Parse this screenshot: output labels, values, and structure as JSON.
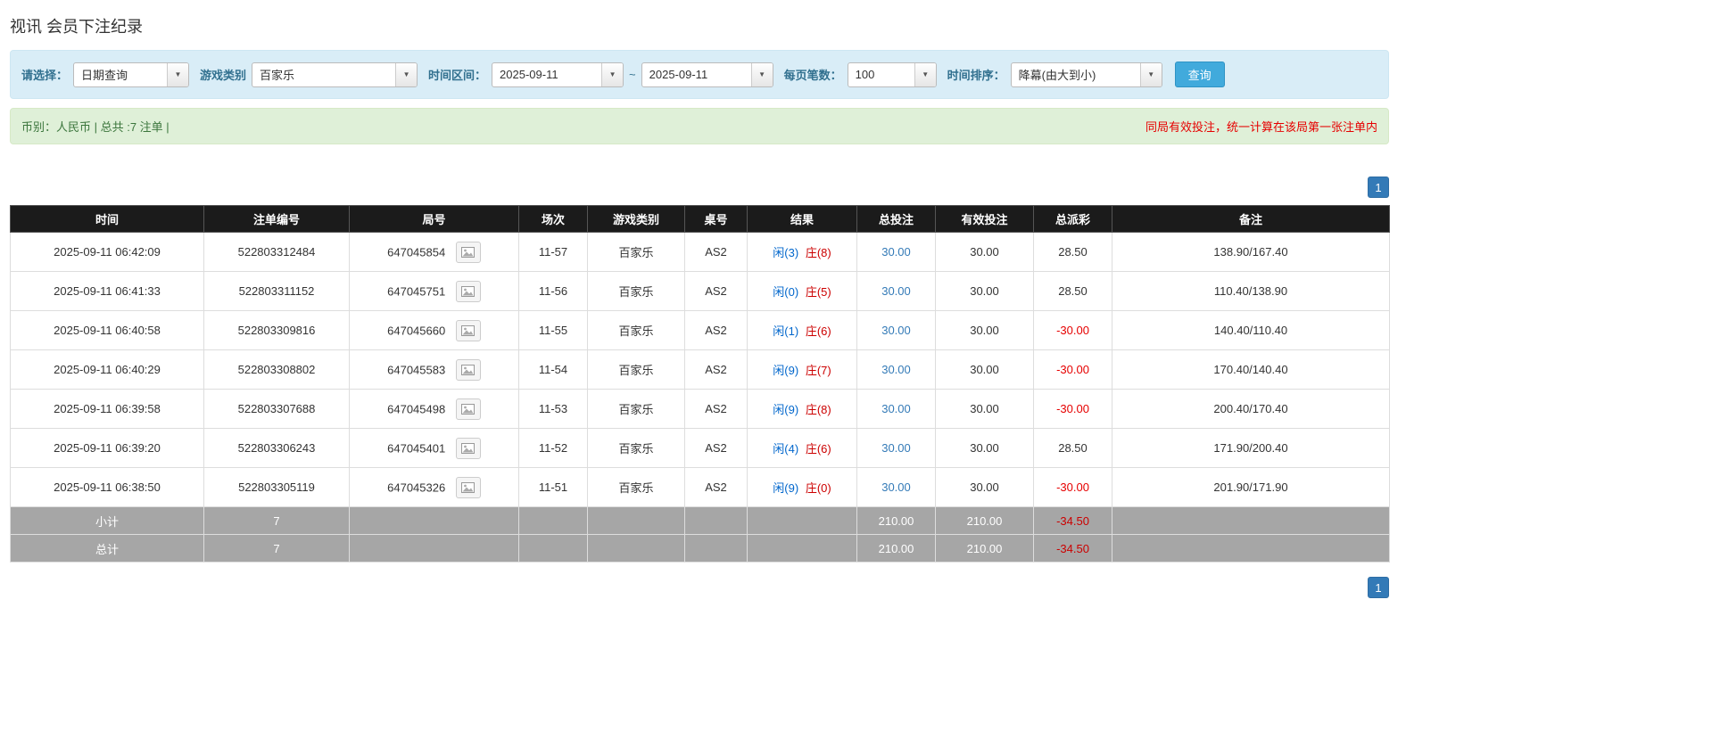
{
  "page": {
    "title": "视讯 会员下注纪录"
  },
  "filters": {
    "select_label": "请选择：",
    "select_value": "日期查询",
    "game_type_label": "游戏类别",
    "game_type_value": "百家乐",
    "date_range_label": "时间区间：",
    "date_from": "2025-09-11",
    "tilde": "~",
    "date_to": "2025-09-11",
    "page_size_label": "每页笔数：",
    "page_size_value": "100",
    "sort_label": "时间排序：",
    "sort_value": "降幕(由大到小)",
    "search_button": "查询",
    "arrow_glyph": "▼"
  },
  "summary": {
    "left": "币别：人民币 | 总共 :7 注单 |",
    "right": "同局有效投注，统一计算在该局第一张注单内"
  },
  "pagination": {
    "page": "1"
  },
  "table": {
    "headers": [
      "时间",
      "注单编号",
      "局号",
      "场次",
      "游戏类别",
      "桌号",
      "结果",
      "总投注",
      "有效投注",
      "总派彩",
      "备注"
    ],
    "rows": [
      {
        "time": "2025-09-11 06:42:09",
        "bet_id": "522803312484",
        "round_id": "647045854",
        "session": "11-57",
        "game": "百家乐",
        "table_no": "AS2",
        "result_player": "闲(3)",
        "result_banker": "庄(8)",
        "total_bet": "30.00",
        "valid_bet": "30.00",
        "payout": "28.50",
        "remark": "138.90/167.40"
      },
      {
        "time": "2025-09-11 06:41:33",
        "bet_id": "522803311152",
        "round_id": "647045751",
        "session": "11-56",
        "game": "百家乐",
        "table_no": "AS2",
        "result_player": "闲(0)",
        "result_banker": "庄(5)",
        "total_bet": "30.00",
        "valid_bet": "30.00",
        "payout": "28.50",
        "remark": "110.40/138.90"
      },
      {
        "time": "2025-09-11 06:40:58",
        "bet_id": "522803309816",
        "round_id": "647045660",
        "session": "11-55",
        "game": "百家乐",
        "table_no": "AS2",
        "result_player": "闲(1)",
        "result_banker": "庄(6)",
        "total_bet": "30.00",
        "valid_bet": "30.00",
        "payout": "-30.00",
        "remark": "140.40/110.40"
      },
      {
        "time": "2025-09-11 06:40:29",
        "bet_id": "522803308802",
        "round_id": "647045583",
        "session": "11-54",
        "game": "百家乐",
        "table_no": "AS2",
        "result_player": "闲(9)",
        "result_banker": "庄(7)",
        "total_bet": "30.00",
        "valid_bet": "30.00",
        "payout": "-30.00",
        "remark": "170.40/140.40"
      },
      {
        "time": "2025-09-11 06:39:58",
        "bet_id": "522803307688",
        "round_id": "647045498",
        "session": "11-53",
        "game": "百家乐",
        "table_no": "AS2",
        "result_player": "闲(9)",
        "result_banker": "庄(8)",
        "total_bet": "30.00",
        "valid_bet": "30.00",
        "payout": "-30.00",
        "remark": "200.40/170.40"
      },
      {
        "time": "2025-09-11 06:39:20",
        "bet_id": "522803306243",
        "round_id": "647045401",
        "session": "11-52",
        "game": "百家乐",
        "table_no": "AS2",
        "result_player": "闲(4)",
        "result_banker": "庄(6)",
        "total_bet": "30.00",
        "valid_bet": "30.00",
        "payout": "28.50",
        "remark": "171.90/200.40"
      },
      {
        "time": "2025-09-11 06:38:50",
        "bet_id": "522803305119",
        "round_id": "647045326",
        "session": "11-51",
        "game": "百家乐",
        "table_no": "AS2",
        "result_player": "闲(9)",
        "result_banker": "庄(0)",
        "total_bet": "30.00",
        "valid_bet": "30.00",
        "payout": "-30.00",
        "remark": "201.90/171.90"
      }
    ],
    "subtotal": {
      "label": "小计",
      "count": "7",
      "total_bet": "210.00",
      "valid_bet": "210.00",
      "payout": "-34.50"
    },
    "total": {
      "label": "总计",
      "count": "7",
      "total_bet": "210.00",
      "valid_bet": "210.00",
      "payout": "-34.50"
    }
  },
  "colors": {
    "accent_blue": "#337ab7",
    "query_button_blue": "#41aadc",
    "filter_bar_bg": "#d9edf7",
    "info_bar_bg": "#dff0d8",
    "warning_red": "#e60000",
    "player_blue": "#0066cc",
    "banker_red": "#cc0000",
    "negative_red": "#e60000",
    "table_header_bg": "#1b1b1b",
    "footer_row_bg": "#a6a6a6"
  }
}
